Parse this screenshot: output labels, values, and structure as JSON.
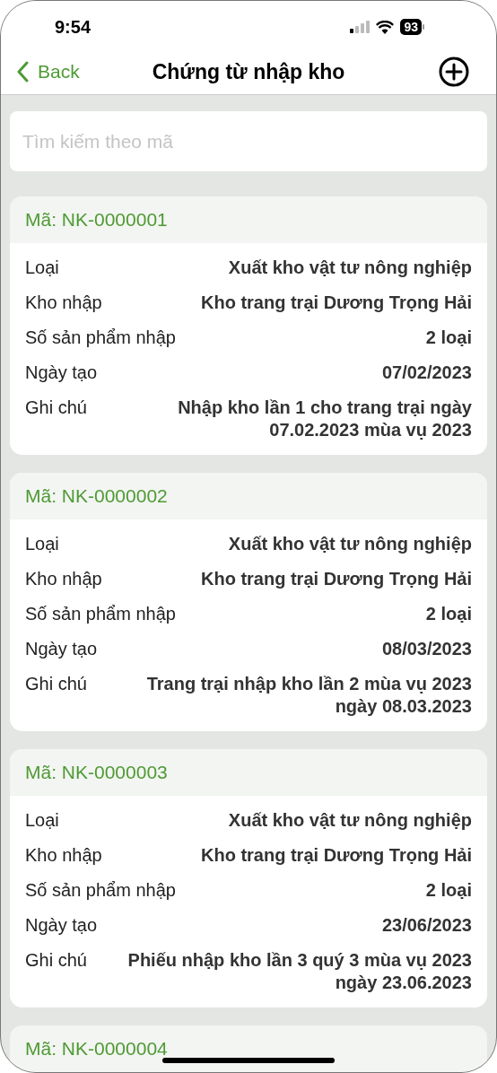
{
  "status_bar": {
    "time": "9:54",
    "battery": "93"
  },
  "nav": {
    "back": "Back",
    "title": "Chứng từ nhập kho"
  },
  "search": {
    "placeholder": "Tìm kiếm theo mã"
  },
  "records": [
    {
      "code": "Mã: NK-0000001",
      "fields": [
        {
          "label": "Loại",
          "value": "Xuất kho vật tư nông nghiệp"
        },
        {
          "label": "Kho nhập",
          "value": "Kho trang trại Dương Trọng Hải"
        },
        {
          "label": "Số sản phẩm nhập",
          "value": "2 loại"
        },
        {
          "label": "Ngày tạo",
          "value": "07/02/2023"
        },
        {
          "label": "Ghi chú",
          "value": "Nhập kho lần 1 cho trang trại ngày 07.02.2023 mùa vụ 2023"
        }
      ]
    },
    {
      "code": "Mã: NK-0000002",
      "fields": [
        {
          "label": "Loại",
          "value": "Xuất kho vật tư nông nghiệp"
        },
        {
          "label": "Kho nhập",
          "value": "Kho trang trại Dương Trọng Hải"
        },
        {
          "label": "Số sản phẩm nhập",
          "value": "2 loại"
        },
        {
          "label": "Ngày tạo",
          "value": "08/03/2023"
        },
        {
          "label": "Ghi chú",
          "value": "Trang trại nhập kho lần 2 mùa vụ 2023 ngày 08.03.2023"
        }
      ]
    },
    {
      "code": "Mã: NK-0000003",
      "fields": [
        {
          "label": "Loại",
          "value": "Xuất kho vật tư nông nghiệp"
        },
        {
          "label": "Kho nhập",
          "value": "Kho trang trại Dương Trọng Hải"
        },
        {
          "label": "Số sản phẩm nhập",
          "value": "2 loại"
        },
        {
          "label": "Ngày tạo",
          "value": "23/06/2023"
        },
        {
          "label": "Ghi chú",
          "value": "Phiếu nhập kho lần 3 quý 3 mùa vụ 2023 ngày 23.06.2023"
        }
      ]
    },
    {
      "code": "Mã: NK-0000004"
    }
  ]
}
